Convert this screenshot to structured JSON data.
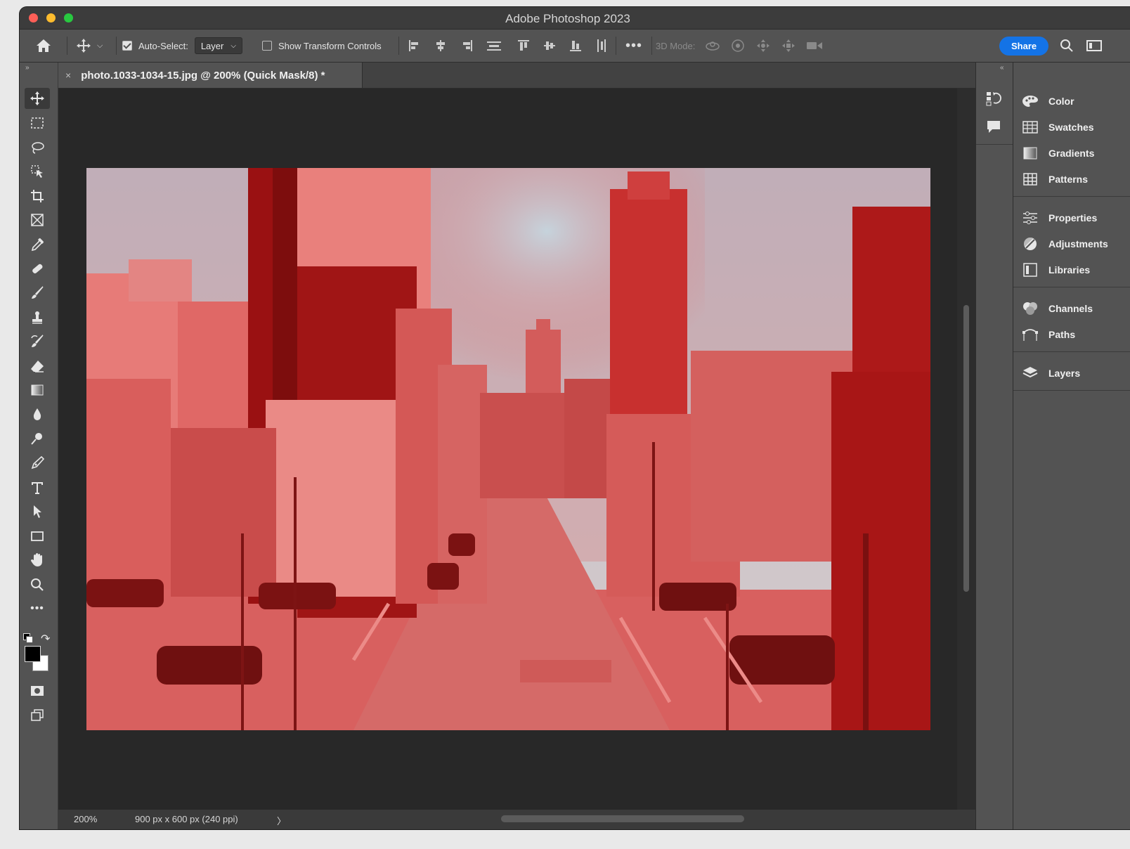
{
  "window": {
    "title": "Adobe Photoshop 2023"
  },
  "options_bar": {
    "auto_select_label": "Auto-Select:",
    "auto_select_value": "Layer",
    "show_transform_label": "Show Transform Controls",
    "mode_3d_label": "3D Mode:",
    "share_label": "Share"
  },
  "document": {
    "tab_title": "photo.1033-1034-15.jpg @ 200% (Quick Mask/8) *",
    "close_glyph": "×"
  },
  "status_bar": {
    "zoom": "200%",
    "doc_info": "900 px x 600 px (240 ppi)",
    "arrow": "〉"
  },
  "tools": [
    "move-tool-icon",
    "marquee-tool-icon",
    "lasso-tool-icon",
    "object-select-tool-icon",
    "crop-tool-icon",
    "frame-tool-icon",
    "eyedropper-tool-icon",
    "healing-tool-icon",
    "brush-tool-icon",
    "stamp-tool-icon",
    "history-brush-tool-icon",
    "eraser-tool-icon",
    "gradient-tool-icon",
    "blur-tool-icon",
    "dodge-tool-icon",
    "pen-tool-icon",
    "type-tool-icon",
    "path-select-tool-icon",
    "rectangle-tool-icon",
    "hand-tool-icon",
    "zoom-tool-icon",
    "more-tools-icon"
  ],
  "colors": {
    "foreground": "#000000",
    "background": "#ffffff",
    "mask_overlay": "#e23a3a"
  },
  "panels": {
    "color": "Color",
    "swatches": "Swatches",
    "gradients": "Gradients",
    "patterns": "Patterns",
    "properties": "Properties",
    "adjustments": "Adjustments",
    "libraries": "Libraries",
    "channels": "Channels",
    "paths": "Paths",
    "layers": "Layers"
  }
}
